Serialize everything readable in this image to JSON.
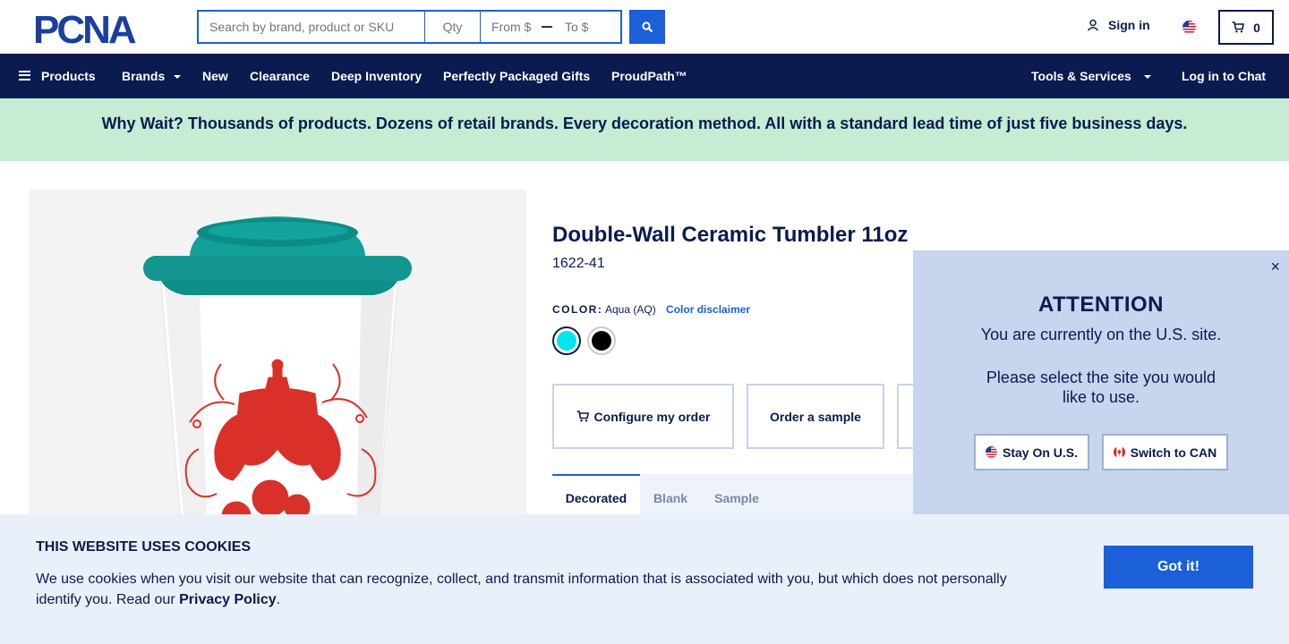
{
  "header": {
    "logo_text": "PCNA",
    "search_placeholder": "Search by brand, product or SKU",
    "qty_placeholder": "Qty",
    "price_from_placeholder": "From $",
    "price_to_placeholder": "To $",
    "signin_label": "Sign in",
    "cart_count": "0"
  },
  "nav": {
    "products": "Products",
    "brands": "Brands",
    "new": "New",
    "clearance": "Clearance",
    "deep_inventory": "Deep Inventory",
    "gifts": "Perfectly Packaged Gifts",
    "proudpath": "ProudPath™",
    "tools": "Tools & Services",
    "chat": "Log in to Chat"
  },
  "banner": {
    "text": "Why Wait? Thousands of products. Dozens of retail brands. Every decoration method. All with a standard lead time of just five business days."
  },
  "product": {
    "title": "Double-Wall Ceramic Tumbler 11oz",
    "sku": "1622-41",
    "color_label": "COLOR:",
    "color_value": "Aqua (AQ)",
    "color_disclaimer": "Color disclaimer",
    "swatches": [
      {
        "name": "Aqua",
        "color": "#00e5ee"
      },
      {
        "name": "Black",
        "color": "#000000"
      }
    ],
    "configure_label": "Configure my order",
    "sample_label": "Order a sample",
    "tabs": [
      "Decorated",
      "Blank",
      "Sample"
    ]
  },
  "attention": {
    "title": "ATTENTION",
    "line1": "You are currently on the U.S. site.",
    "line2": "Please select the site you would like to use.",
    "stay_label": "Stay On U.S.",
    "switch_label": "Switch to CAN",
    "close": "×"
  },
  "cookies": {
    "title": "THIS WEBSITE USES COOKIES",
    "text": "We use cookies when you visit our website that can recognize, collect, and transmit information that is associated with you, but which does not personally identify you. Read our",
    "link": "Privacy Policy",
    "period": ".",
    "button": "Got it!"
  },
  "colors": {
    "navy": "#0b1a4f",
    "accent": "#1b5fd9",
    "banner_bg": "#c6ecd4",
    "lid_teal": "#0f8f8a",
    "print_red": "#d9312a"
  }
}
